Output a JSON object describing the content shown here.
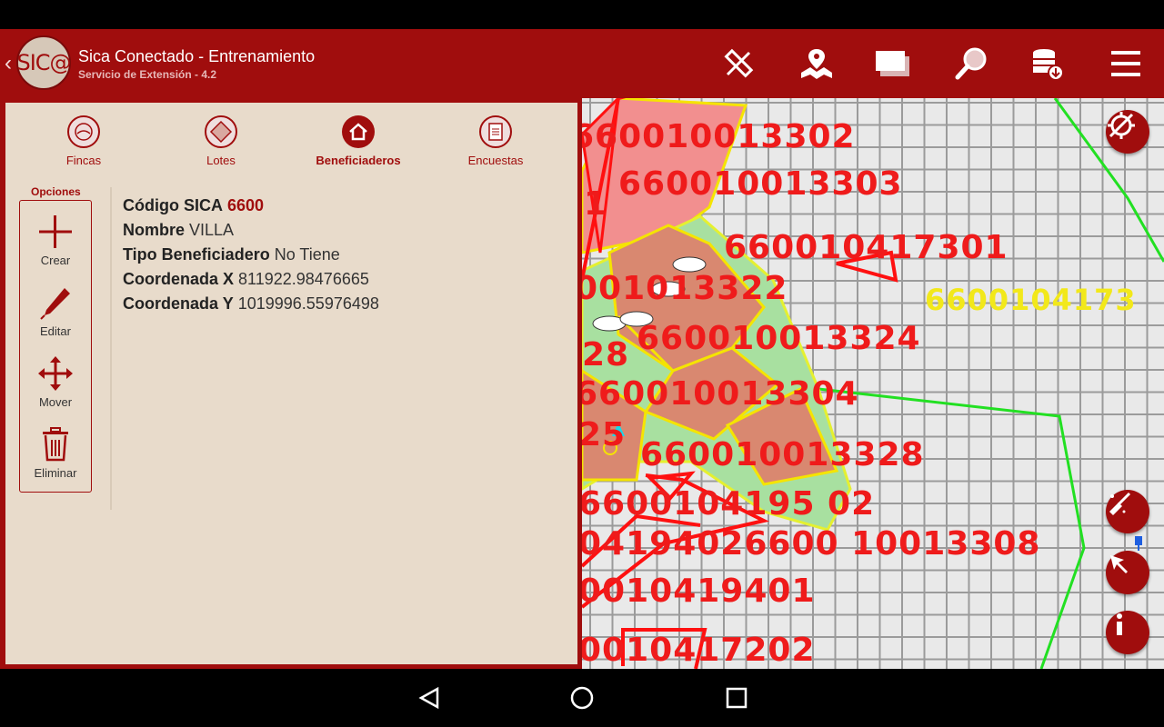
{
  "app": {
    "title": "Sica Conectado - Entrenamiento",
    "subtitle": "Servicio de Extensión - 4.2",
    "logo_text": "SIC@",
    "back_glyph": "‹"
  },
  "toolbar": {
    "icons": [
      "ruler-pencil-icon",
      "map-pin-icon",
      "layers-icon",
      "search-icon",
      "database-download-icon",
      "menu-icon"
    ]
  },
  "tabs": [
    {
      "label": "Fincas",
      "icon": "fincas-icon"
    },
    {
      "label": "Lotes",
      "icon": "lotes-icon"
    },
    {
      "label": "Beneficiaderos",
      "icon": "house-icon",
      "active": true
    },
    {
      "label": "Encuestas",
      "icon": "document-icon"
    }
  ],
  "options": {
    "title": "Opciones",
    "items": [
      {
        "label": "Crear",
        "icon": "plus-icon"
      },
      {
        "label": "Editar",
        "icon": "pen-icon"
      },
      {
        "label": "Mover",
        "icon": "move-icon"
      },
      {
        "label": "Eliminar",
        "icon": "trash-icon"
      }
    ]
  },
  "details": {
    "codigo_label": "Código SICA",
    "codigo_value": "6600",
    "nombre_label": "Nombre",
    "nombre_value": "VILLA",
    "tipo_label": "Tipo Beneficiadero",
    "tipo_value": "No Tiene",
    "coord_x_label": "Coordenada X",
    "coord_x_value": "811922.98476665",
    "coord_y_label": "Coordenada Y",
    "coord_y_value": "1019996.55976498"
  },
  "map": {
    "labels": [
      "660010013302",
      "01",
      "660010013303",
      "660010417301",
      "6600104173",
      "001013322",
      "660010013324",
      "28",
      "660010013304",
      "25",
      "660010013328",
      "6600104195 02",
      "04194026600 10013308",
      "0010419401",
      "0010417202"
    ]
  },
  "colors": {
    "primary": "#a00d0d",
    "panel_bg": "#e8dbcb",
    "map_label_red": "#ef1b1b",
    "map_label_yellow": "#f2e81a",
    "boundary_green": "#22e022"
  }
}
